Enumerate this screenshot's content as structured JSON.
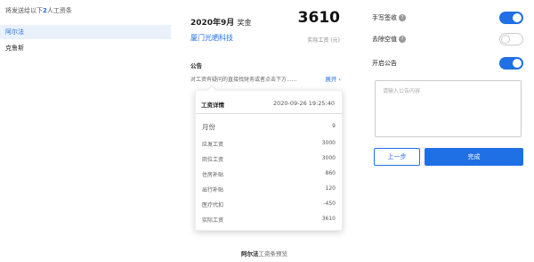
{
  "left": {
    "header_prefix": "将发送给以下",
    "header_count": "2",
    "header_suffix": "人工资条",
    "recipients": [
      {
        "name": "阿尔法",
        "active": true
      },
      {
        "name": "克鲁斯",
        "active": false
      }
    ]
  },
  "card": {
    "month": "2020年9月",
    "bonus_label": "奖金",
    "amount": "3610",
    "company": "厦门光晒科技",
    "amount_label": "实际工资 (元)",
    "notice_title": "公告",
    "notice_text": "对工资有疑问的直接找财务或者点击下方......",
    "expand_label": "展开",
    "detail": {
      "title": "工资详情",
      "time": "2020-09-26 19:25:40",
      "rows": [
        {
          "label": "月份",
          "value": "9"
        },
        {
          "label": "应发工资",
          "value": "3000"
        },
        {
          "label": "岗位工资",
          "value": "3000"
        },
        {
          "label": "住房补贴",
          "value": "860"
        },
        {
          "label": "出行补贴",
          "value": "120"
        },
        {
          "label": "医疗代扣",
          "value": "-450"
        },
        {
          "label": "实际工资",
          "value": "3610"
        }
      ]
    },
    "preview_name": "阿尔法",
    "preview_suffix": "工资条预览"
  },
  "settings": {
    "items": [
      {
        "label": "手写签收",
        "help": true,
        "on": true
      },
      {
        "label": "去除空值",
        "help": true,
        "on": false
      },
      {
        "label": "开启公告",
        "help": false,
        "on": true
      }
    ],
    "notice_placeholder": "请输入公告内容",
    "back_label": "上一步",
    "done_label": "完成"
  },
  "colors": {
    "accent": "#1f6fe5"
  }
}
